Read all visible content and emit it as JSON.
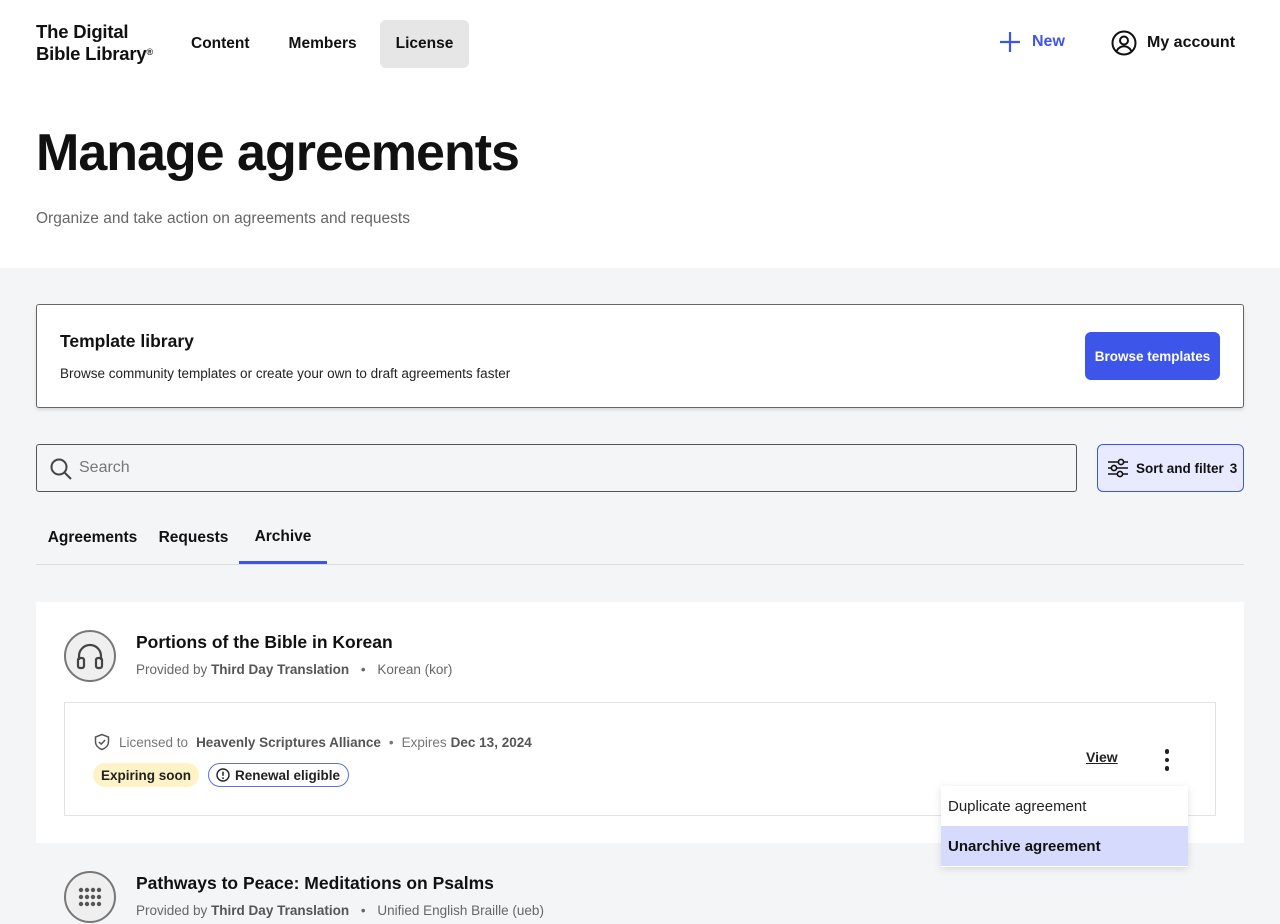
{
  "header": {
    "logo_line1": "The Digital",
    "logo_line2": "Bible Library",
    "logo_mark": "®",
    "nav": [
      {
        "label": "Content"
      },
      {
        "label": "Members"
      },
      {
        "label": "License"
      }
    ],
    "new_label": "New",
    "account_label": "My account"
  },
  "hero": {
    "title": "Manage agreements",
    "subtitle": "Organize and take action on agreements and requests"
  },
  "template_library": {
    "title": "Template library",
    "description": "Browse community templates or create your own to draft agreements faster",
    "button_label": "Browse templates"
  },
  "search": {
    "placeholder": "Search"
  },
  "sort_filter": {
    "label": "Sort and filter",
    "count": "3"
  },
  "tabs": [
    {
      "label": "Agreements"
    },
    {
      "label": "Requests"
    },
    {
      "label": "Archive"
    }
  ],
  "agreements": [
    {
      "title": "Portions of the Bible in Korean",
      "provided_prefix": "Provided by",
      "provider": "Third Day Translation",
      "language": "Korean (kor)",
      "licensed_prefix": "Licensed to",
      "licensee": "Heavenly Scriptures Alliance",
      "expires_prefix": "Expires",
      "expires": "Dec 13, 2024",
      "badge_expiring": "Expiring soon",
      "badge_renewal": "Renewal eligible",
      "view_label": "View"
    },
    {
      "title": "Pathways to Peace: Meditations on Psalms",
      "provided_prefix": "Provided by",
      "provider": "Third Day Translation",
      "language": "Unified English Braille (ueb)"
    }
  ],
  "menu": {
    "items": [
      {
        "label": "Duplicate agreement"
      },
      {
        "label": "Unarchive agreement"
      }
    ]
  },
  "colors": {
    "accent": "#3d55e8",
    "accent_light": "#e8eaff",
    "expiring_bg": "#fdf3c7",
    "menu_highlight": "#d6dafd"
  }
}
